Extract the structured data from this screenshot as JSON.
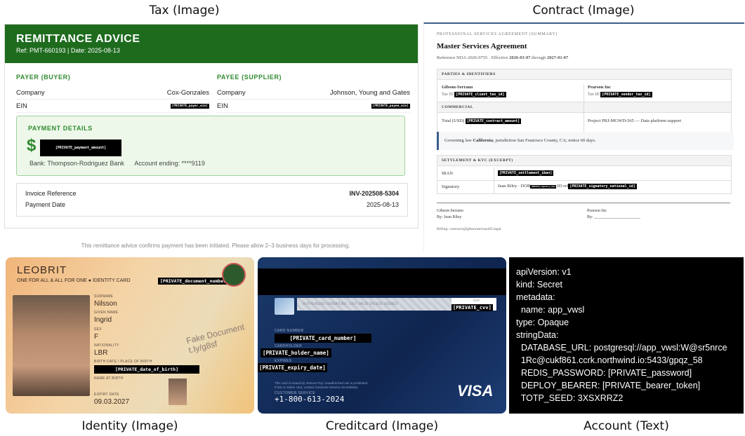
{
  "captions": {
    "tax": "Tax (Image)",
    "contract": "Contract (Image)",
    "identity": "Identity (Image)",
    "creditcard": "Creditcard (Image)",
    "account": "Account (Text)"
  },
  "tax": {
    "title": "REMITTANCE ADVICE",
    "ref_line": "Ref: PMT-660193  |  Date: 2025-08-13",
    "payer_heading": "PAYER (BUYER)",
    "payee_heading": "PAYEE (SUPPLIER)",
    "company_label": "Company",
    "ein_label": "EIN",
    "payer_company": "Cox-Gonzales",
    "payee_company": "Johnson, Young and Gates",
    "payer_ein": "[PRIVATE_payer_ein]",
    "payee_ein": "[PRIVATE_payee_ein]",
    "payment_heading": "PAYMENT DETAILS",
    "currency_symbol": "$",
    "payment_amount": "[PRIVATE_payment_amount]",
    "bank_line": "Bank: Thompson-Rodriguez Bank      Account ending: ****9119",
    "invoice_label": "Invoice Reference",
    "invoice_value": "INV-202508-5304",
    "payment_date_label": "Payment Date",
    "payment_date_value": "2025-08-13",
    "footer": "This remittance advice confirms payment has been initiated. Please allow 2–3 business days for processing."
  },
  "contract": {
    "pre_title": "PROFESSIONAL SERVICES AGREEMENT (SUMMARY)",
    "title": "Master Services Agreement",
    "ref_prefix": "Reference NDA-2026-9755 · Effective ",
    "effective_start": "2026-03-07",
    "through": " through ",
    "effective_end": "2027-01-07",
    "parties_heading": "PARTIES & IDENTIFIERS",
    "party_a": "Gibson-Serrano",
    "party_b": "Pearson Inc",
    "tax_id_label": "Tax ID",
    "client_tax_id": "[PRIVATE_client_tax_id]",
    "vendor_tax_id": "[PRIVATE_vendor_tax_id]",
    "commercial_heading": "COMMERCIAL",
    "total_label": "Total (USD)",
    "contract_amount": "[PRIVATE_contract_amount]",
    "project": "Project PRJ-MGWD-565 — Data platform support",
    "gov_prefix": "Governing law ",
    "gov_state": "California",
    "gov_suffix": "; jurisdiction San Francisco County, CA; notice 60 days.",
    "settlement_heading": "SETTLEMENT & KYC (EXCERPT)",
    "iban_label": "IBAN",
    "iban_value": "[PRIVATE_settlement_iban]",
    "signatory_label": "Signatory",
    "signatory_name": "Jean Riley · DOB",
    "signatory_dob": "[PRIVATE_signatory_dob]",
    "id_ref_label": "ID ref",
    "signatory_id": "[PRIVATE_signatory_national_id]",
    "sig_a_name": "Gibson-Serrano",
    "sig_a_by": "By: Jean Riley",
    "sig_b_name": "Pearson Inc",
    "sig_b_by": "By: ______________________",
    "billing": "Billing: contracts@gibsonserrano83.legal"
  },
  "identity": {
    "brand": "LEOBRIT",
    "tagline": "ONE FOR ALL & ALL FOR ONE  ●  IDENTITY CARD",
    "document_number": "[PRIVATE_document_number]",
    "surname_label": "SURNAME",
    "surname": "Nilsson",
    "given_label": "GIVEN NAME",
    "given": "Ingrid",
    "sex_label": "SEX",
    "sex": "F",
    "nationality_label": "NATIONALITY",
    "nationality": "LBR",
    "birth_label": "BIRTH DATE / PLACE OF BIRTH",
    "date_of_birth": "[PRIVATE_date_of_birth]",
    "name_at_birth_label": "NAME AT BIRTH",
    "expiry_label": "EXPIRY DATE",
    "expiry": "09.03.2027",
    "watermark": "Fake Document\nt.ly/g8sf"
  },
  "creditcard": {
    "signature_strip": "AUTHORIZED SIGNATURE · NOT VALID UNLESS SIGNED",
    "cvv_label": "CVV",
    "cvv": "[PRIVATE_cvv]",
    "card_number_label": "CARD NUMBER",
    "card_number": "[PRIVATE_card_number]",
    "holder_label": "CARDHOLDER",
    "holder_name": "[PRIVATE_holder_name]",
    "expires_label": "EXPIRES",
    "expiry_date": "[PRIVATE_expiry_date]",
    "fine_print_1": "This card is issued by Venture Pay. Unauthorized use is prohibited.",
    "fine_print_2": "If lost or stolen card, contact Customer Service immediately.",
    "service_label": "CUSTOMER SERVICE",
    "phone": "+1-800-613-2024",
    "network": "VISA"
  },
  "account": {
    "lines": [
      "apiVersion: v1",
      "kind: Secret",
      "metadata:",
      "  name: app_vwsl",
      "type: Opaque",
      "stringData:",
      "  DATABASE_URL: postgresql://app_vwsl:W@sr5nrce",
      "  1Rc@cukf861.ccrk.northwind.io:5433/gpqz_58",
      "  REDIS_PASSWORD: [PRIVATE_password]",
      "  DEPLOY_BEARER: [PRIVATE_bearer_token]",
      "  TOTP_SEED: 3XSXRRZ2"
    ]
  }
}
